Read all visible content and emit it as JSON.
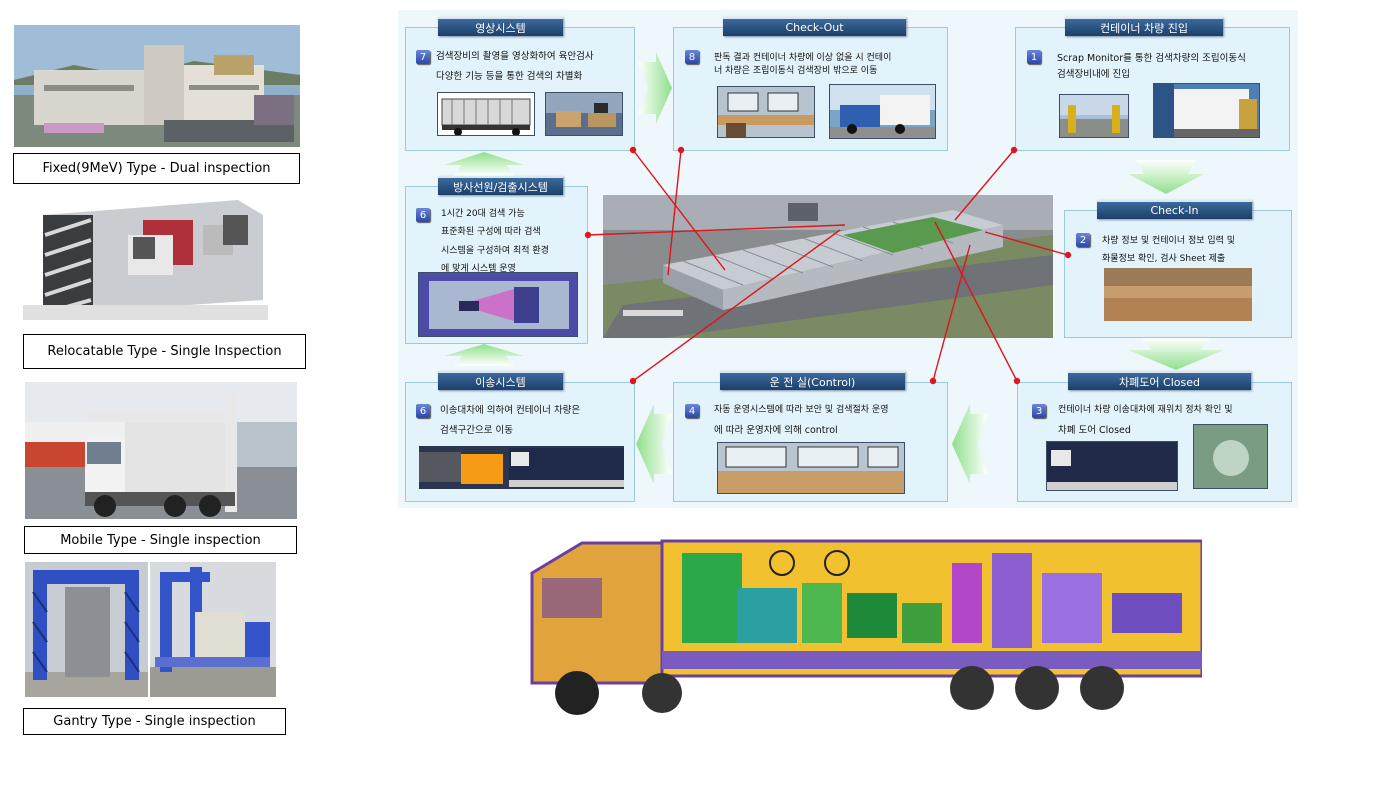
{
  "left_types": [
    {
      "caption": "Fixed(9MeV) Type - Dual inspection"
    },
    {
      "caption": "Relocatable Type - Single Inspection"
    },
    {
      "caption": "Mobile Type - Single inspection"
    },
    {
      "caption": "Gantry Type - Single inspection"
    }
  ],
  "steps": {
    "video": {
      "title": "영상시스템",
      "num": "7",
      "text": [
        "검색장비의 촬영을 영상화하여 육안검사",
        "다양한 기능 등을 통한 검색의 차별화"
      ]
    },
    "checkout": {
      "title": "Check-Out",
      "num": "8",
      "text": [
        "판독 결과 컨테이너 차량에 이상 없을 시 컨테이",
        "너 차량은 조립이동식 검색장비 밖으로 이동"
      ]
    },
    "entry": {
      "title": "컨테이너 차량 진입",
      "num": "1",
      "text": [
        "Scrap Monitor를 통한 검색차량의 조립이동식",
        "검색장비내에 진입"
      ]
    },
    "radiation": {
      "title": "방사선원/검출시스템",
      "num": "6",
      "text": [
        "1시간 20대 검색 가능",
        "표준화된 구성에 따라 검색",
        "시스템을 구성하여 최적 환경",
        "에 맞게 시스템 운영"
      ]
    },
    "checkin": {
      "title": "Check-In",
      "num": "2",
      "text": [
        "차량 정보 및 컨테이너 정보 입력 및",
        "화물정보 확인, 검사 Sheet 제출"
      ]
    },
    "transport": {
      "title": "이송시스템",
      "num": "6",
      "text": [
        "이송대차에 의하여 컨테이너 차량은",
        "검색구간으로 이동"
      ]
    },
    "control": {
      "title": "운 전 실(Control)",
      "num": "4",
      "text": [
        "자동 운영시스템에 따라 보안 및 검색절차 운영",
        "에 따라 운영자에 의해 control"
      ]
    },
    "door": {
      "title": "차폐도어 Closed",
      "num": "3",
      "text": [
        "컨테이너 차량 이송대차에 재위치 정차 확인 및",
        "차폐 도어 Closed"
      ]
    }
  },
  "colors": {
    "banner": "#1d3f6a",
    "panel": "#e3f3fb",
    "arrow": "#a8e6a0",
    "connector": "#e0141c"
  }
}
